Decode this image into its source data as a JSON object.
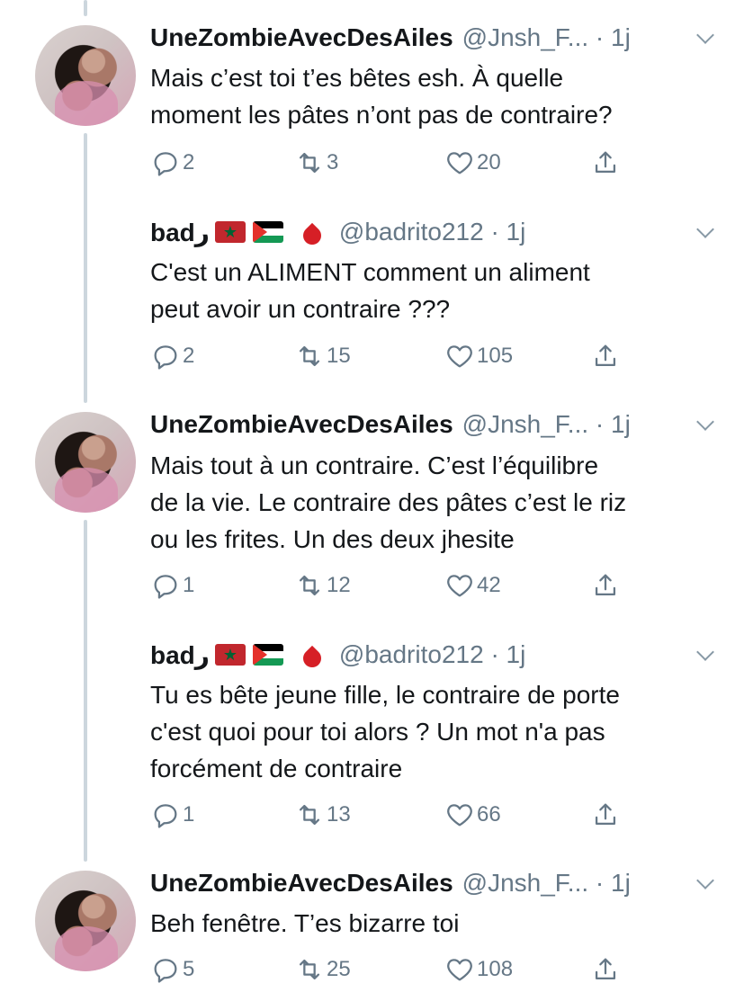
{
  "tweets": [
    {
      "name": "UneZombieAvecDesAiles",
      "handle": "@Jnsh_F... · 1j",
      "text": "Mais c’est toi t’es bêtes esh. À quelle\nmoment les pâtes n’ont pas de contraire?",
      "replies": "2",
      "retweets": "3",
      "likes": "20"
    },
    {
      "name": "badر",
      "handle": "@badrito212 · 1j",
      "text": "C'est un ALIMENT comment un aliment\npeut avoir un contraire ???",
      "replies": "2",
      "retweets": "15",
      "likes": "105"
    },
    {
      "name": "UneZombieAvecDesAiles",
      "handle": "@Jnsh_F... · 1j",
      "text": "Mais tout à un contraire. C’est l’équilibre\nde la vie. Le contraire des pâtes c’est le riz\nou les frites. Un des deux jhesite",
      "replies": "1",
      "retweets": "12",
      "likes": "42"
    },
    {
      "name": "badر",
      "handle": "@badrito212 · 1j",
      "text": "Tu es bête jeune fille, le contraire de porte\nc'est quoi pour toi alors ? Un mot n'a pas\nforcément de contraire",
      "replies": "1",
      "retweets": "13",
      "likes": "66"
    },
    {
      "name": "UneZombieAvecDesAiles",
      "handle": "@Jnsh_F... · 1j",
      "text": "Beh fenêtre. T’es bizarre toi",
      "replies": "5",
      "retweets": "25",
      "likes": "108"
    }
  ],
  "icons": {
    "reply": "reply-icon",
    "retweet": "retweet-icon",
    "like": "heart-icon",
    "share": "share-icon",
    "menu": "chevron-down-icon",
    "emoji": [
      "morocco-flag-icon",
      "palestine-flag-icon",
      "blood-drop-icon"
    ]
  },
  "colors": {
    "text": "#14171a",
    "secondary": "#657786",
    "thread": "#ccd6dd",
    "drop": "#d61f26"
  }
}
